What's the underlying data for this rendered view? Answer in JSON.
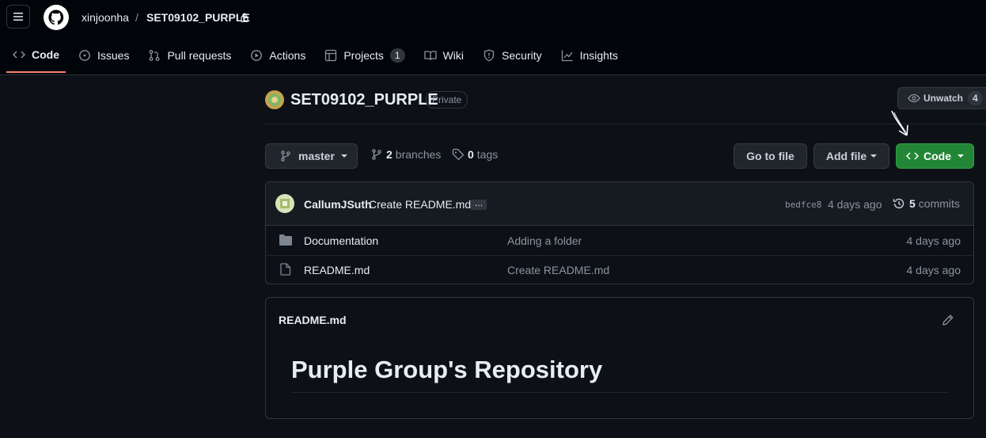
{
  "header": {
    "owner": "xinjoonha",
    "separator": "/",
    "repo": "SET09102_PURPLE"
  },
  "tabs": [
    {
      "label": "Code",
      "icon": "code-icon"
    },
    {
      "label": "Issues",
      "icon": "issue-icon"
    },
    {
      "label": "Pull requests",
      "icon": "pull-request-icon"
    },
    {
      "label": "Actions",
      "icon": "play-icon"
    },
    {
      "label": "Projects",
      "icon": "table-icon",
      "count": "1"
    },
    {
      "label": "Wiki",
      "icon": "book-icon"
    },
    {
      "label": "Security",
      "icon": "shield-icon"
    },
    {
      "label": "Insights",
      "icon": "graph-icon"
    }
  ],
  "repo": {
    "title": "SET09102_PURPLE",
    "visibility": "Private",
    "watch_label": "Unwatch",
    "watch_count": "4"
  },
  "toolbar": {
    "branch": "master",
    "branches_count": "2",
    "branches_label": "branches",
    "tags_count": "0",
    "tags_label": "tags",
    "goto_file": "Go to file",
    "add_file": "Add file",
    "code": "Code"
  },
  "commit": {
    "author": "CallumJSuth",
    "message": "Create README.md",
    "ellipsis": "…",
    "hash": "bedfce8",
    "time": "4 days ago",
    "commits_count": "5",
    "commits_label": "commits"
  },
  "files": [
    {
      "name": "Documentation",
      "type": "folder",
      "message": "Adding a folder",
      "time": "4 days ago"
    },
    {
      "name": "README.md",
      "type": "file",
      "message": "Create README.md",
      "time": "4 days ago"
    }
  ],
  "readme": {
    "filename": "README.md",
    "heading": "Purple Group's Repository"
  },
  "colors": {
    "accent_green": "#238636",
    "tab_underline": "#f78166",
    "background": "#0d1117"
  }
}
